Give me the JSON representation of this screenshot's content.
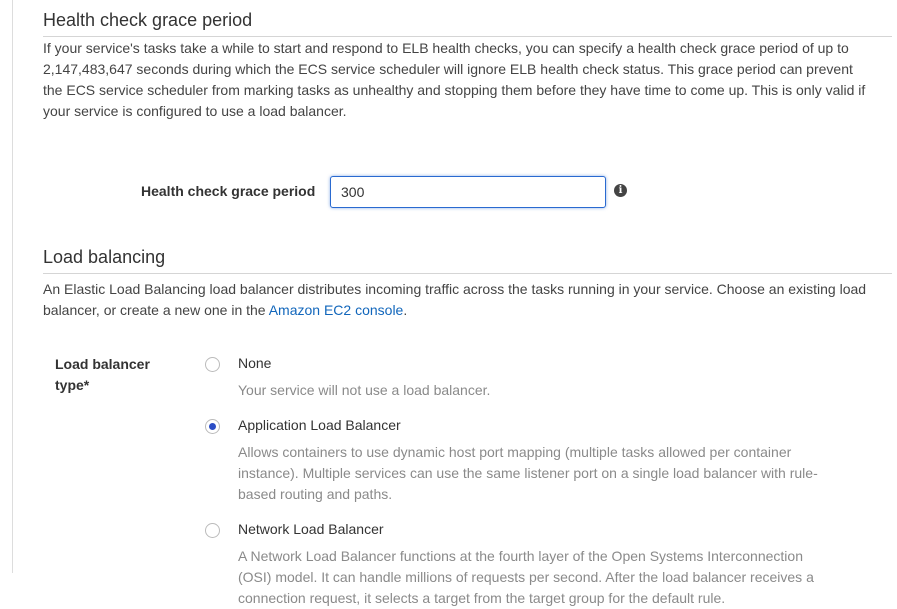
{
  "health_check": {
    "title": "Health check grace period",
    "description": "If your service's tasks take a while to start and respond to ELB health checks, you can specify a health check grace period of up to 2,147,483,647 seconds during which the ECS service scheduler will ignore ELB health check status. This grace period can prevent the ECS service scheduler from marking tasks as unhealthy and stopping them before they have time to come up. This is only valid if your service is configured to use a load balancer.",
    "field_label": "Health check grace period",
    "value": "300",
    "info_icon": "info-icon"
  },
  "load_balancing": {
    "title": "Load balancing",
    "description_before_link": "An Elastic Load Balancing load balancer distributes incoming traffic across the tasks running in your service. Choose an existing load balancer, or create a new one in the ",
    "link_text": "Amazon EC2 console",
    "description_after_link": ".",
    "type_label": "Load balancer type*",
    "options": [
      {
        "label": "None",
        "description": "Your service will not use a load balancer.",
        "selected": false
      },
      {
        "label": "Application Load Balancer",
        "description": "Allows containers to use dynamic host port mapping (multiple tasks allowed per container instance). Multiple services can use the same listener port on a single load balancer with rule-based routing and paths.",
        "selected": true
      },
      {
        "label": "Network Load Balancer",
        "description": "A Network Load Balancer functions at the fourth layer of the Open Systems Interconnection (OSI) model. It can handle millions of requests per second. After the load balancer receives a connection request, it selects a target from the target group for the default rule.",
        "selected": false
      }
    ]
  },
  "colors": {
    "accent": "#2b4dc5",
    "link": "#1166bb",
    "input_focus_border": "#2a6ad0",
    "muted_text": "#8a8a8a"
  }
}
